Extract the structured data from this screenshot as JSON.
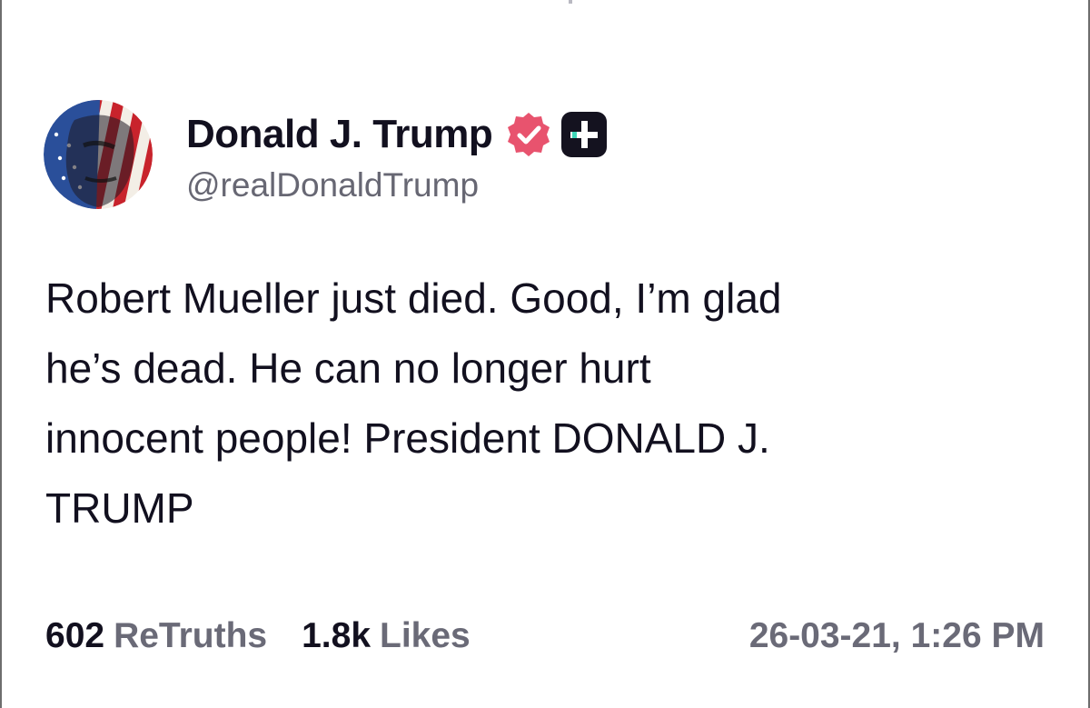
{
  "post": {
    "author": {
      "display_name": "Donald J. Trump",
      "handle": "@realDonaldTrump",
      "badges": [
        "verified-badge-icon",
        "plus-badge-icon"
      ]
    },
    "body_text": "Robert Mueller just died. Good, I’m glad\nhe’s dead. He can no longer hurt\ninnocent people! President DONALD J.\nTRUMP",
    "stats": {
      "retruths_count": "602",
      "retruths_label": "ReTruths",
      "likes_count": "1.8k",
      "likes_label": "Likes"
    },
    "timestamp": "26-03-21, 1:26 PM"
  },
  "colors": {
    "text_primary": "#12101f",
    "text_secondary": "#6a6a77",
    "verified_badge": "#e8536e",
    "plus_badge": "#14121f",
    "plus_badge_accent": "#3ed6b8"
  }
}
